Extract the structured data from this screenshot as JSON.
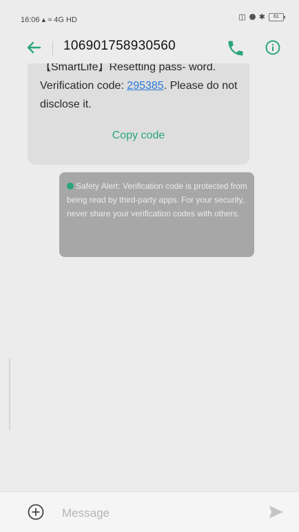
{
  "status_bar": {
    "time": "16:06",
    "signal_text": "4G",
    "network_label": "HD",
    "battery": "61"
  },
  "header": {
    "title": "106901758930560"
  },
  "message": {
    "text_before_code": "【SmartLife】Resetting pass- word. Verification code: ",
    "code": "295385",
    "text_after_code": ". Please do not disclose it.",
    "copy_label": "Copy code"
  },
  "safety_alert": {
    "text": "Safety Alert: Verification code is protected from being read by third-party apps. For your security, never share your verification codes with others."
  },
  "composer": {
    "placeholder": "Message"
  },
  "colors": {
    "accent": "#2aa57e",
    "link": "#2a79d8",
    "incoming_bubble": "#dedede",
    "alert_bubble": "#a7a7a7"
  }
}
